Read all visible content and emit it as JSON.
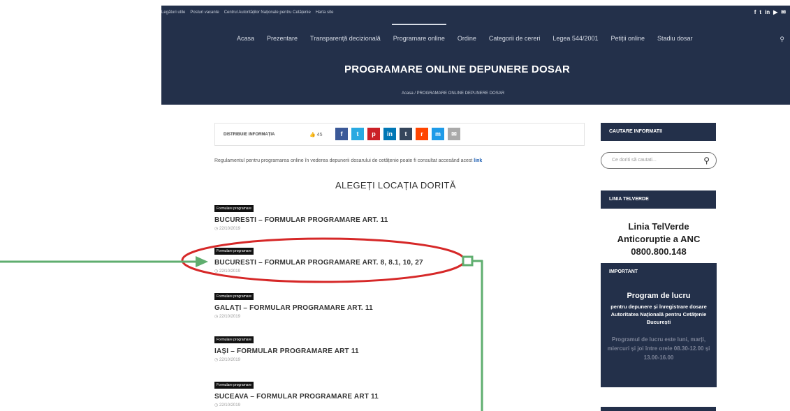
{
  "topbar": {
    "links": [
      "Legături utile",
      "Posturi vacante",
      "Centrul Autorităților Naționale pentru Cetățenie",
      "Harta site"
    ],
    "social": [
      "f",
      "t",
      "in",
      "▶",
      "✉"
    ]
  },
  "nav": {
    "items": [
      "Acasa",
      "Prezentare",
      "Transparență decizională",
      "Programare online",
      "Ordine",
      "Categorii de cereri",
      "Legea 544/2001",
      "Petiții online",
      "Stadiu dosar"
    ],
    "search_icon": "search-icon"
  },
  "page_title": "PROGRAMARE ONLINE DEPUNERE DOSAR",
  "breadcrumb": "Acasa  /  PROGRAMARE ONLINE DEPUNERE DOSAR",
  "share": {
    "label": "DISTRIBUIE INFORMAȚIA",
    "count": "45",
    "buttons": [
      {
        "icon": "f",
        "color": "#3b5998"
      },
      {
        "icon": "t",
        "color": "#29a9e1"
      },
      {
        "icon": "p",
        "color": "#cb2027"
      },
      {
        "icon": "in",
        "color": "#0077b5"
      },
      {
        "icon": "t",
        "color": "#35465c"
      },
      {
        "icon": "r",
        "color": "#ff4500"
      },
      {
        "icon": "m",
        "color": "#1e9be8"
      },
      {
        "icon": "✉",
        "color": "#aaaaaa"
      }
    ]
  },
  "intro": {
    "text": "Regulamentul pentru programarea online în vederea depunerii dosarului de cetățenie poate fi consultat accesând acest ",
    "link": "link"
  },
  "choose_location": "ALEGEȚI LOCAȚIA DORITĂ",
  "items": [
    {
      "badge": "Formulare programare",
      "title": "BUCURESTI – FORMULAR PROGRAMARE ART. 11",
      "date": "22/10/2019"
    },
    {
      "badge": "Formulare programare",
      "title": "BUCURESTI – FORMULAR PROGRAMARE ART. 8, 8.1, 10, 27",
      "date": "22/10/2019"
    },
    {
      "badge": "Formulare programare",
      "title": "GALAȚI – FORMULAR PROGRAMARE ART. 11",
      "date": "22/10/2019"
    },
    {
      "badge": "Formulare programare",
      "title": "IAȘI – FORMULAR PROGRAMARE ART 11",
      "date": "22/10/2019"
    },
    {
      "badge": "Formulare programare",
      "title": "SUCEAVA – FORMULAR PROGRAMARE ART 11",
      "date": "22/10/2019"
    }
  ],
  "sidebar": {
    "search_head": "CAUTARE INFORMATII",
    "search_placeholder": "Ce doriti să cautati...",
    "hotline_head": "LINIA TELVERDE",
    "hotline": "Linia TelVerde Anticoruptie a ANC 0800.800.148",
    "important_head": "IMPORTANT",
    "important_title": "Program de lucru",
    "important_body": "pentru depunere și înregistrare dosare Autoritatea Națională pentru Cetățenie București",
    "important_muted": "Programul de lucru este luni, marți, miercuri și joi între orele 08.30-12.00 și 13.00-16.00"
  },
  "annotation": {
    "color": "#5fae6f",
    "ellipse_color": "#d62828"
  }
}
